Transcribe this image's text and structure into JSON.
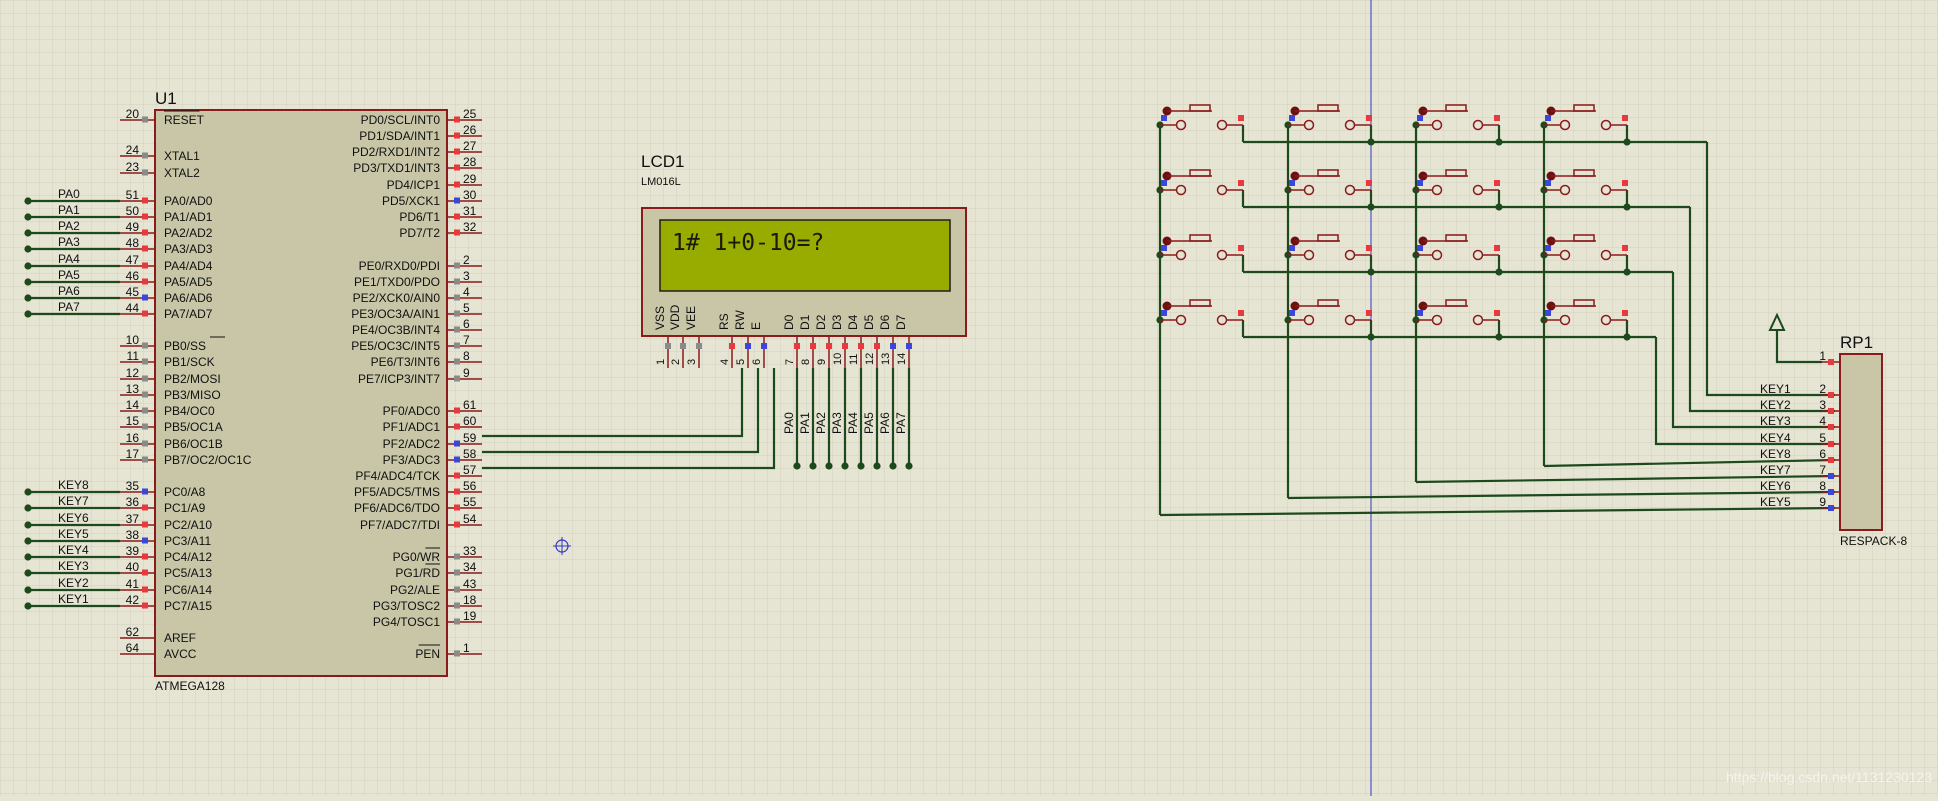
{
  "colors": {
    "background": "#e6e5d3",
    "grid": "#d4d4c2",
    "component_outline": "#8b1a1a",
    "component_fill": "#c8c6a7",
    "wire": "#1c4a1c",
    "pin_red": "#e8393f",
    "pin_blue": "#3a47d9",
    "pin_gray": "#8a8a8a",
    "lcd_screen": "#98ac00",
    "crosshair": "#2f36c4",
    "text": "#101010"
  },
  "mcu": {
    "ref": "U1",
    "part": "ATMEGA128",
    "left_pins": [
      {
        "num": "20",
        "name": "RESET",
        "overline": true,
        "color": "gray"
      },
      {
        "num": "24",
        "name": "XTAL1",
        "color": "gray"
      },
      {
        "num": "23",
        "name": "XTAL2",
        "color": "gray"
      },
      {
        "num": "51",
        "name": "PA0/AD0",
        "color": "red",
        "net": "PA0"
      },
      {
        "num": "50",
        "name": "PA1/AD1",
        "color": "red",
        "net": "PA1"
      },
      {
        "num": "49",
        "name": "PA2/AD2",
        "color": "red",
        "net": "PA2"
      },
      {
        "num": "48",
        "name": "PA3/AD3",
        "color": "red",
        "net": "PA3"
      },
      {
        "num": "47",
        "name": "PA4/AD4",
        "color": "red",
        "net": "PA4"
      },
      {
        "num": "46",
        "name": "PA5/AD5",
        "color": "red",
        "net": "PA5"
      },
      {
        "num": "45",
        "name": "PA6/AD6",
        "color": "blue",
        "net": "PA6"
      },
      {
        "num": "44",
        "name": "PA7/AD7",
        "color": "red",
        "net": "PA7"
      },
      {
        "num": "10",
        "name": "PB0/SS",
        "color": "gray"
      },
      {
        "num": "11",
        "name": "PB1/SCK",
        "color": "gray"
      },
      {
        "num": "12",
        "name": "PB2/MOSI",
        "color": "gray"
      },
      {
        "num": "13",
        "name": "PB3/MISO",
        "color": "gray"
      },
      {
        "num": "14",
        "name": "PB4/OC0",
        "color": "gray"
      },
      {
        "num": "15",
        "name": "PB5/OC1A",
        "color": "gray"
      },
      {
        "num": "16",
        "name": "PB6/OC1B",
        "color": "gray"
      },
      {
        "num": "17",
        "name": "PB7/OC2/OC1C",
        "color": "gray"
      },
      {
        "num": "35",
        "name": "PC0/A8",
        "color": "blue",
        "net": "KEY8"
      },
      {
        "num": "36",
        "name": "PC1/A9",
        "color": "red",
        "net": "KEY7"
      },
      {
        "num": "37",
        "name": "PC2/A10",
        "color": "red",
        "net": "KEY6"
      },
      {
        "num": "38",
        "name": "PC3/A11",
        "color": "blue",
        "net": "KEY5"
      },
      {
        "num": "39",
        "name": "PC4/A12",
        "color": "red",
        "net": "KEY4"
      },
      {
        "num": "40",
        "name": "PC5/A13",
        "color": "red",
        "net": "KEY3"
      },
      {
        "num": "41",
        "name": "PC6/A14",
        "color": "red",
        "net": "KEY2"
      },
      {
        "num": "42",
        "name": "PC7/A15",
        "color": "red",
        "net": "KEY1"
      },
      {
        "num": "62",
        "name": "AREF",
        "color": "none"
      },
      {
        "num": "64",
        "name": "AVCC",
        "color": "none"
      }
    ],
    "right_pins": [
      {
        "num": "25",
        "name": "PD0/SCL/INT0",
        "color": "red"
      },
      {
        "num": "26",
        "name": "PD1/SDA/INT1",
        "color": "red"
      },
      {
        "num": "27",
        "name": "PD2/RXD1/INT2",
        "color": "red"
      },
      {
        "num": "28",
        "name": "PD3/TXD1/INT3",
        "color": "red"
      },
      {
        "num": "29",
        "name": "PD4/ICP1",
        "color": "red"
      },
      {
        "num": "30",
        "name": "PD5/XCK1",
        "color": "blue"
      },
      {
        "num": "31",
        "name": "PD6/T1",
        "color": "red"
      },
      {
        "num": "32",
        "name": "PD7/T2",
        "color": "red"
      },
      {
        "num": "2",
        "name": "PE0/RXD0/PDI",
        "color": "gray"
      },
      {
        "num": "3",
        "name": "PE1/TXD0/PDO",
        "color": "gray"
      },
      {
        "num": "4",
        "name": "PE2/XCK0/AIN0",
        "color": "gray"
      },
      {
        "num": "5",
        "name": "PE3/OC3A/AIN1",
        "color": "gray"
      },
      {
        "num": "6",
        "name": "PE4/OC3B/INT4",
        "color": "gray"
      },
      {
        "num": "7",
        "name": "PE5/OC3C/INT5",
        "color": "gray"
      },
      {
        "num": "8",
        "name": "PE6/T3/INT6",
        "color": "gray"
      },
      {
        "num": "9",
        "name": "PE7/ICP3/INT7",
        "color": "gray"
      },
      {
        "num": "61",
        "name": "PF0/ADC0",
        "color": "red"
      },
      {
        "num": "60",
        "name": "PF1/ADC1",
        "color": "red"
      },
      {
        "num": "59",
        "name": "PF2/ADC2",
        "color": "blue"
      },
      {
        "num": "58",
        "name": "PF3/ADC3",
        "color": "blue"
      },
      {
        "num": "57",
        "name": "PF4/ADC4/TCK",
        "color": "red"
      },
      {
        "num": "56",
        "name": "PF5/ADC5/TMS",
        "color": "red"
      },
      {
        "num": "55",
        "name": "PF6/ADC6/TDO",
        "color": "red"
      },
      {
        "num": "54",
        "name": "PF7/ADC7/TDI",
        "color": "red"
      },
      {
        "num": "33",
        "name": "PG0/WR",
        "overline_from": 4,
        "color": "gray"
      },
      {
        "num": "34",
        "name": "PG1/RD",
        "overline_from": 4,
        "color": "gray"
      },
      {
        "num": "43",
        "name": "PG2/ALE",
        "color": "gray"
      },
      {
        "num": "18",
        "name": "PG3/TOSC2",
        "color": "gray"
      },
      {
        "num": "19",
        "name": "PG4/TOSC1",
        "color": "gray"
      },
      {
        "num": "1",
        "name": "PEN",
        "overline": true,
        "color": "gray"
      }
    ]
  },
  "lcd": {
    "ref": "LCD1",
    "part": "LM016L",
    "display_text": "1# 1+0-10=?",
    "pins": [
      {
        "num": "1",
        "name": "VSS",
        "color": "gray"
      },
      {
        "num": "2",
        "name": "VDD",
        "color": "gray"
      },
      {
        "num": "3",
        "name": "VEE",
        "color": "gray"
      },
      {
        "num": "4",
        "name": "RS",
        "color": "red"
      },
      {
        "num": "5",
        "name": "RW",
        "color": "blue"
      },
      {
        "num": "6",
        "name": "E",
        "color": "blue"
      },
      {
        "num": "7",
        "name": "D0",
        "color": "red"
      },
      {
        "num": "8",
        "name": "D1",
        "color": "red"
      },
      {
        "num": "9",
        "name": "D2",
        "color": "red"
      },
      {
        "num": "10",
        "name": "D3",
        "color": "red"
      },
      {
        "num": "11",
        "name": "D4",
        "color": "red"
      },
      {
        "num": "12",
        "name": "D5",
        "color": "red"
      },
      {
        "num": "13",
        "name": "D6",
        "color": "blue"
      },
      {
        "num": "14",
        "name": "D7",
        "color": "blue"
      }
    ],
    "data_nets": [
      "PA0",
      "PA1",
      "PA2",
      "PA3",
      "PA4",
      "PA5",
      "PA6",
      "PA7"
    ]
  },
  "rpack": {
    "ref": "RP1",
    "part": "RESPACK-8",
    "pins": [
      {
        "num": "1",
        "net": "",
        "color": "red"
      },
      {
        "num": "2",
        "net": "KEY1",
        "color": "red"
      },
      {
        "num": "3",
        "net": "KEY2",
        "color": "red"
      },
      {
        "num": "4",
        "net": "KEY3",
        "color": "red"
      },
      {
        "num": "5",
        "net": "KEY4",
        "color": "red"
      },
      {
        "num": "6",
        "net": "KEY8",
        "color": "red"
      },
      {
        "num": "7",
        "net": "KEY7",
        "color": "blue"
      },
      {
        "num": "8",
        "net": "KEY6",
        "color": "blue"
      },
      {
        "num": "9",
        "net": "KEY5",
        "color": "blue"
      }
    ]
  },
  "watermark": "https://blog.csdn.net/1131230123"
}
